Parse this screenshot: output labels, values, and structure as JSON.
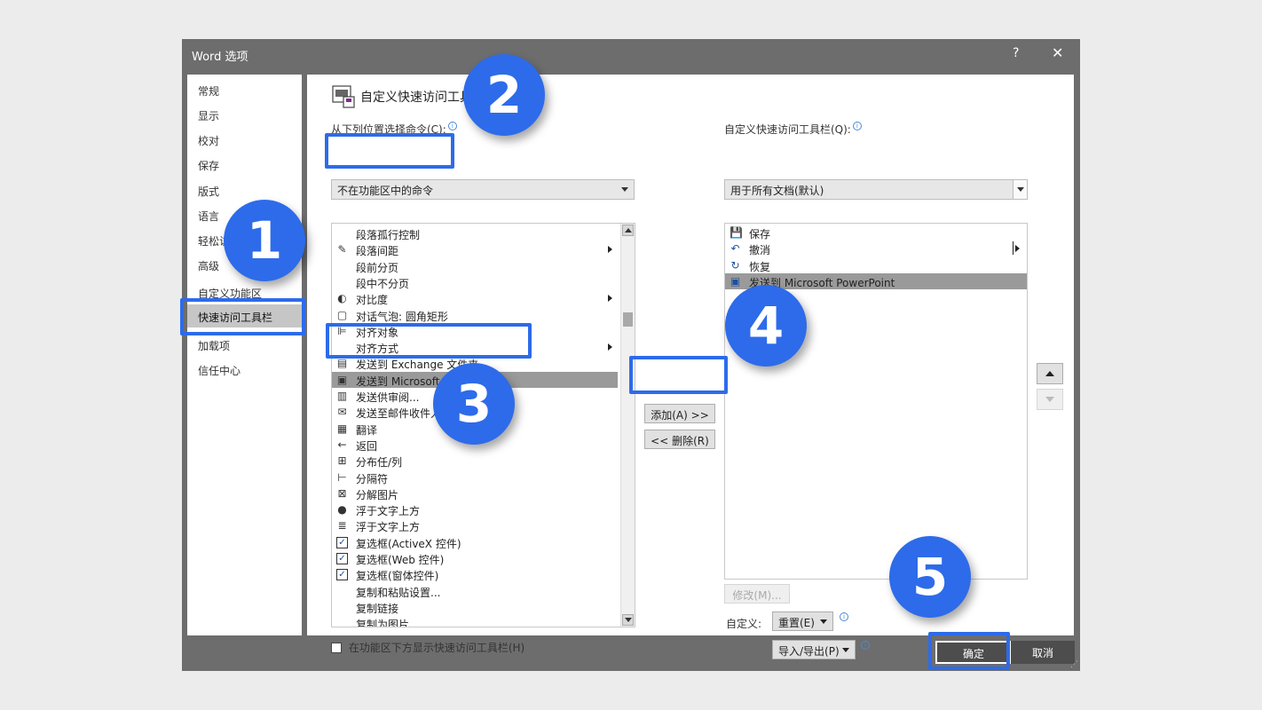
{
  "window": {
    "title": "Word 选项",
    "help": "?",
    "close": "✕"
  },
  "nav": {
    "items": [
      {
        "label": "常规"
      },
      {
        "label": "显示"
      },
      {
        "label": "校对"
      },
      {
        "label": "保存"
      },
      {
        "label": "版式"
      },
      {
        "label": "语言"
      },
      {
        "label": "轻松访问"
      },
      {
        "label": "高级"
      },
      {
        "label": "自定义功能区"
      },
      {
        "label": "快速访问工具栏"
      },
      {
        "label": "加载项"
      },
      {
        "label": "信任中心"
      }
    ],
    "selected": "快速访问工具栏"
  },
  "main": {
    "section_title": "自定义快速访问工具栏",
    "choose_from_label": "从下列位置选择命令(C):",
    "choose_from_value": "不在功能区中的命令",
    "customize_label": "自定义快速访问工具栏(Q):",
    "customize_value": "用于所有文档(默认)",
    "commands": [
      {
        "label": "段落孤行控制",
        "icon": ""
      },
      {
        "label": "段落间距",
        "icon": "✎",
        "sub": true
      },
      {
        "label": "段前分页",
        "icon": ""
      },
      {
        "label": "段中不分页",
        "icon": ""
      },
      {
        "label": "对比度",
        "icon": "◐",
        "sub": true
      },
      {
        "label": "对话气泡: 圆角矩形",
        "icon": "▢"
      },
      {
        "label": "对齐对象",
        "icon": "⊫"
      },
      {
        "label": "对齐方式",
        "icon": "",
        "sub": true
      },
      {
        "label": "发送到 Exchange 文件夹",
        "icon": "▤"
      },
      {
        "label": "发送到 Microsoft PowerPoint",
        "icon": "▣",
        "selected": true
      },
      {
        "label": "发送供审阅...",
        "icon": "▥"
      },
      {
        "label": "发送至邮件收件人",
        "icon": "✉"
      },
      {
        "label": "翻译",
        "icon": "▦"
      },
      {
        "label": "返回",
        "icon": "←"
      },
      {
        "label": "分布任/列",
        "icon": "⊞"
      },
      {
        "label": "分隔符",
        "icon": "⊢"
      },
      {
        "label": "分解图片",
        "icon": "⊠"
      },
      {
        "label": "浮于文字上方",
        "icon": "●"
      },
      {
        "label": "浮于文字上方",
        "icon": "≣"
      },
      {
        "label": "复选框(ActiveX 控件)",
        "icon": "✓",
        "check": true
      },
      {
        "label": "复选框(Web 控件)",
        "icon": "✓",
        "check": true
      },
      {
        "label": "复选框(窗体控件)",
        "icon": "✓",
        "check": true
      },
      {
        "label": "复制和粘贴设置...",
        "icon": ""
      },
      {
        "label": "复制链接",
        "icon": ""
      },
      {
        "label": "复制为图片...",
        "icon": ""
      }
    ],
    "toolbar_items": [
      {
        "label": "保存",
        "icon": "💾"
      },
      {
        "label": "撤消",
        "icon": "↶",
        "sub": true
      },
      {
        "label": "恢复",
        "icon": "↻"
      },
      {
        "label": "发送到 Microsoft PowerPoint",
        "icon": "▣",
        "selected": true
      }
    ],
    "add_button": "添加(A) >>",
    "remove_button": "<< 删除(R)",
    "modify_button": "修改(M)...",
    "customize_text": "自定义:",
    "reset_button": "重置(E)",
    "import_export_button": "导入/导出(P)",
    "show_below_ribbon": "在功能区下方显示快速访问工具栏(H)",
    "show_below_checked": false
  },
  "footer": {
    "ok": "确定",
    "cancel": "取消"
  },
  "callouts": [
    "1",
    "2",
    "3",
    "4",
    "5"
  ],
  "colors": {
    "accent": "#2d6bea",
    "dialog_bg": "#6d6d6d",
    "selected_row": "#9a9a9a"
  }
}
